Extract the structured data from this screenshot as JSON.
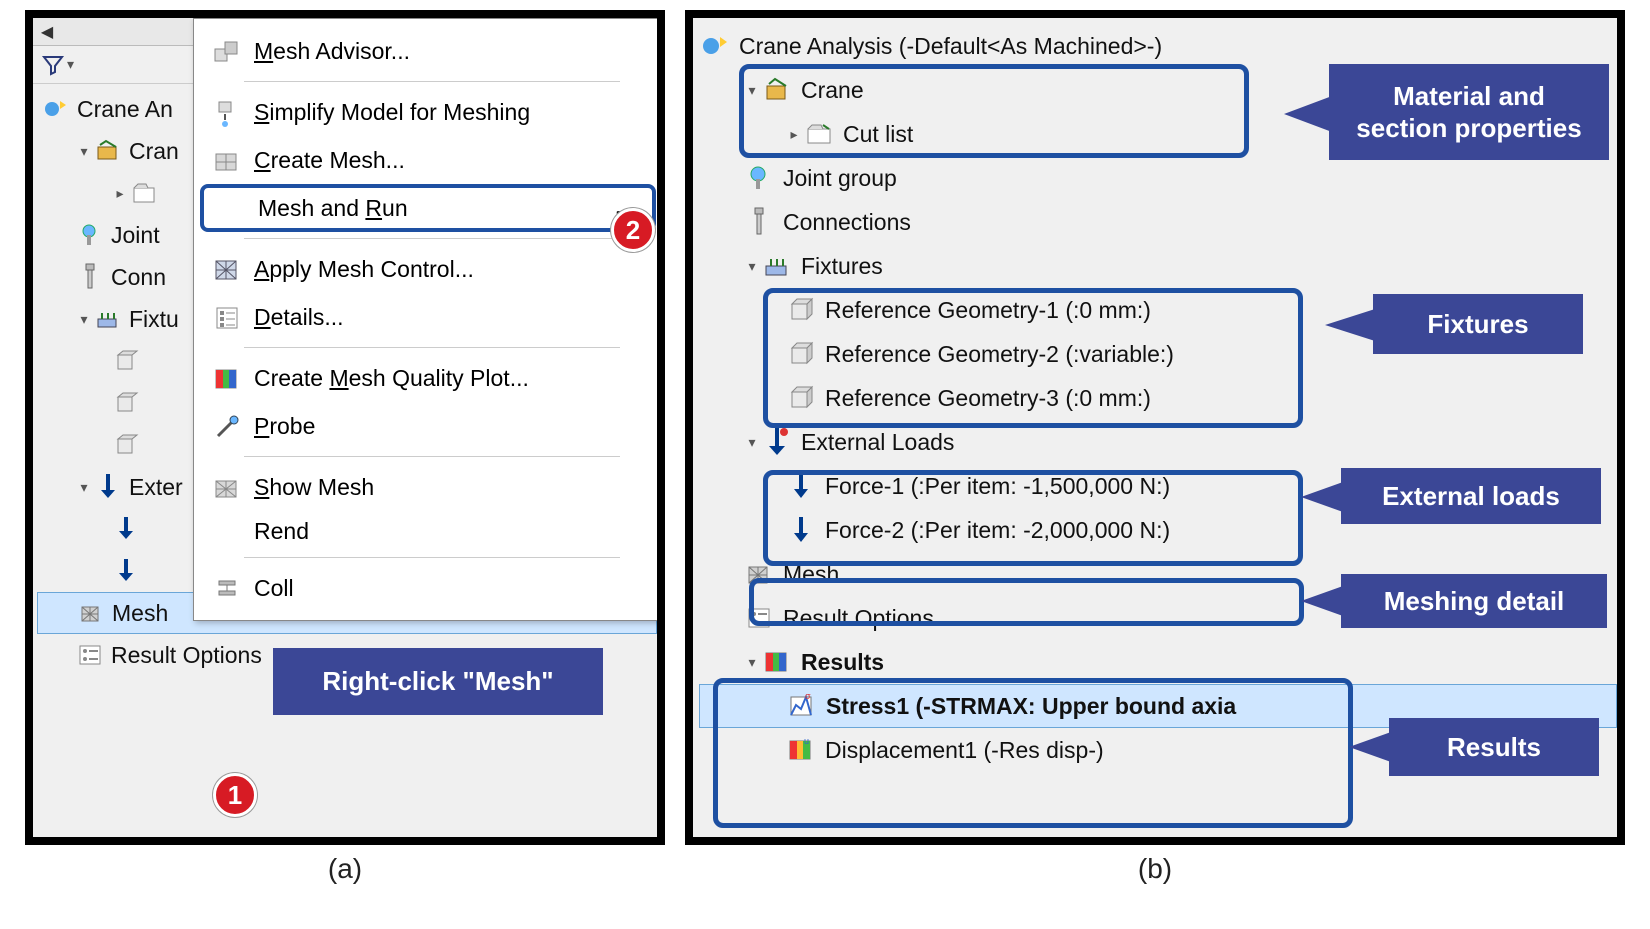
{
  "captions": {
    "a": "(a)",
    "b": "(b)"
  },
  "panelA": {
    "tree": {
      "root": "Crane An",
      "crane": "Cran",
      "joint": "Joint",
      "connections": "Conn",
      "fixtures": "Fixtu",
      "external": "Exter",
      "mesh": "Mesh",
      "resultOptions": "Result Options"
    },
    "menu": {
      "meshAdvisor": "Mesh Advisor...",
      "meshAdvisor_u": "M",
      "simplify": "Simplify Model for Meshing",
      "simplify_u": "S",
      "createMesh": "Create Mesh...",
      "createMesh_u": "C",
      "meshAndRun": "Mesh and Run",
      "meshAndRun_u": "R",
      "applyControl": "Apply Mesh Control...",
      "applyControl_u": "A",
      "details": "Details...",
      "details_u": "D",
      "createQuality": "Create Mesh Quality Plot...",
      "createQuality_u": "M",
      "probe": "Probe",
      "probe_u": "P",
      "showMesh": "Show Mesh",
      "showMesh_u": "S",
      "render": "Rend",
      "collapse": "Coll"
    },
    "badge1": "1",
    "badge2": "2",
    "tooltip": "Right-click \"Mesh\""
  },
  "panelB": {
    "root": "Crane Analysis (-Default<As Machined>-)",
    "crane": "Crane",
    "cutlist": "Cut list",
    "jointGroup": "Joint group",
    "connections": "Connections",
    "fixtures": "Fixtures",
    "ref1": "Reference Geometry-1 (:0 mm:)",
    "ref2": "Reference Geometry-2 (:variable:)",
    "ref3": "Reference Geometry-3 (:0 mm:)",
    "externalLoads": "External Loads",
    "force1": "Force-1 (:Per item: -1,500,000 N:)",
    "force2": "Force-2 (:Per item: -2,000,000 N:)",
    "mesh": "Mesh",
    "resultOptions": "Result Options",
    "results": "Results",
    "stress1": "Stress1 (-STRMAX: Upper bound axia",
    "displacement1": "Displacement1 (-Res disp-)",
    "callouts": {
      "material": "Material and\nsection properties",
      "fixtures": "Fixtures",
      "external": "External loads",
      "meshing": "Meshing detail",
      "results": "Results"
    }
  }
}
